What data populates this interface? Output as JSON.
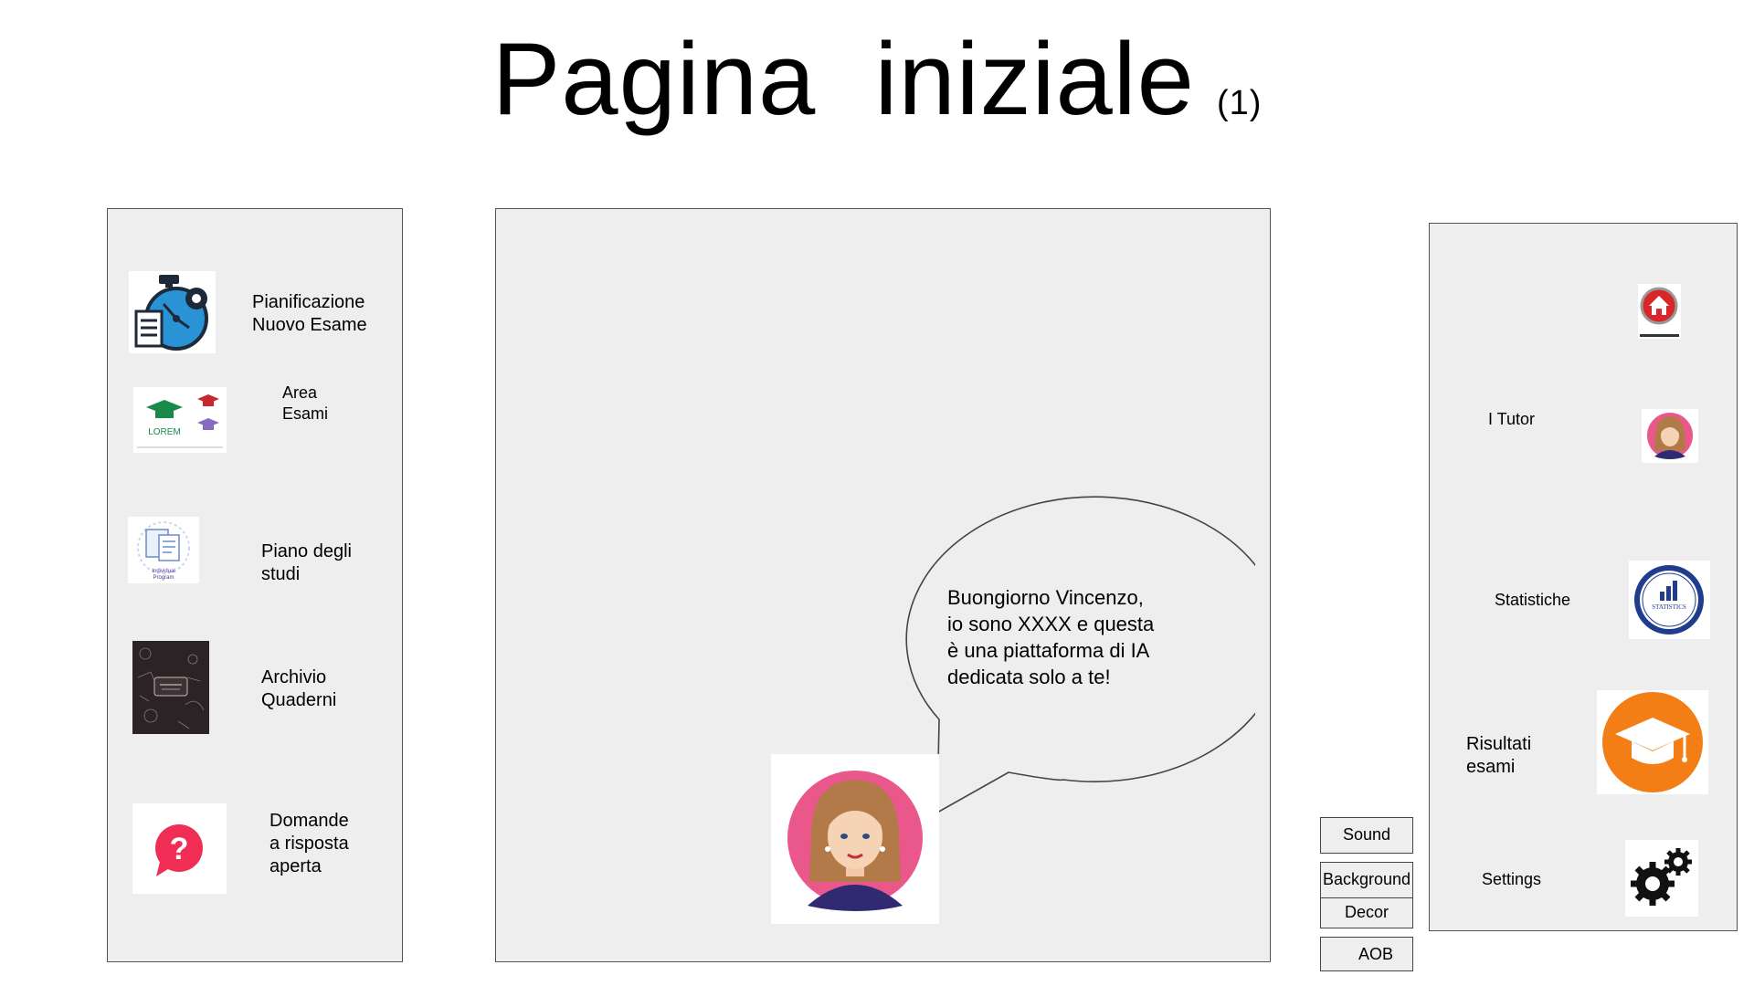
{
  "page": {
    "title": "Pagina  iniziale",
    "title_suffix": "(1)"
  },
  "left_menu": {
    "items": [
      {
        "label": "Pianificazione\nNuovo Esame",
        "icon": "exam-planning-icon"
      },
      {
        "label": "Area\nEsami",
        "icon": "graduation-caps-logo"
      },
      {
        "label": "Piano degli\nstudi",
        "icon": "individual-program-icon"
      },
      {
        "label": "Archivio\nQuaderni",
        "icon": "notebook-cover-icon"
      },
      {
        "label": "Domande\na risposta\naperta",
        "icon": "question-bubble-icon"
      }
    ],
    "logo_text": "LOREM",
    "program_text": "Individual\nProgram"
  },
  "assistant": {
    "message": "Buongiorno Vincenzo,\nio sono XXXX e questa\nè una piattaforma di IA\ndedicata solo a te!",
    "avatar": "woman-avatar"
  },
  "settings_buttons": {
    "sound": "Sound",
    "background": "Background",
    "decor": "Decor",
    "aob": "AOB"
  },
  "right_menu": {
    "items": [
      {
        "label": "",
        "icon": "home-icon"
      },
      {
        "label": "I Tutor",
        "icon": "tutor-avatar-icon"
      },
      {
        "label": "Statistiche",
        "icon": "statistics-icon"
      },
      {
        "label": "Risultati\nesami",
        "icon": "graduation-cap-icon"
      },
      {
        "label": "Settings",
        "icon": "gears-icon"
      }
    ],
    "stats_text": "STATISTICS"
  },
  "colors": {
    "panel_bg": "#eeeeee",
    "question_red": "#f02d55",
    "avatar_pink": "#e9578b",
    "home_red": "#d9262a",
    "stats_blue": "#1f3c8f",
    "results_orange": "#f47e16",
    "exam_blue": "#2a93d6"
  }
}
